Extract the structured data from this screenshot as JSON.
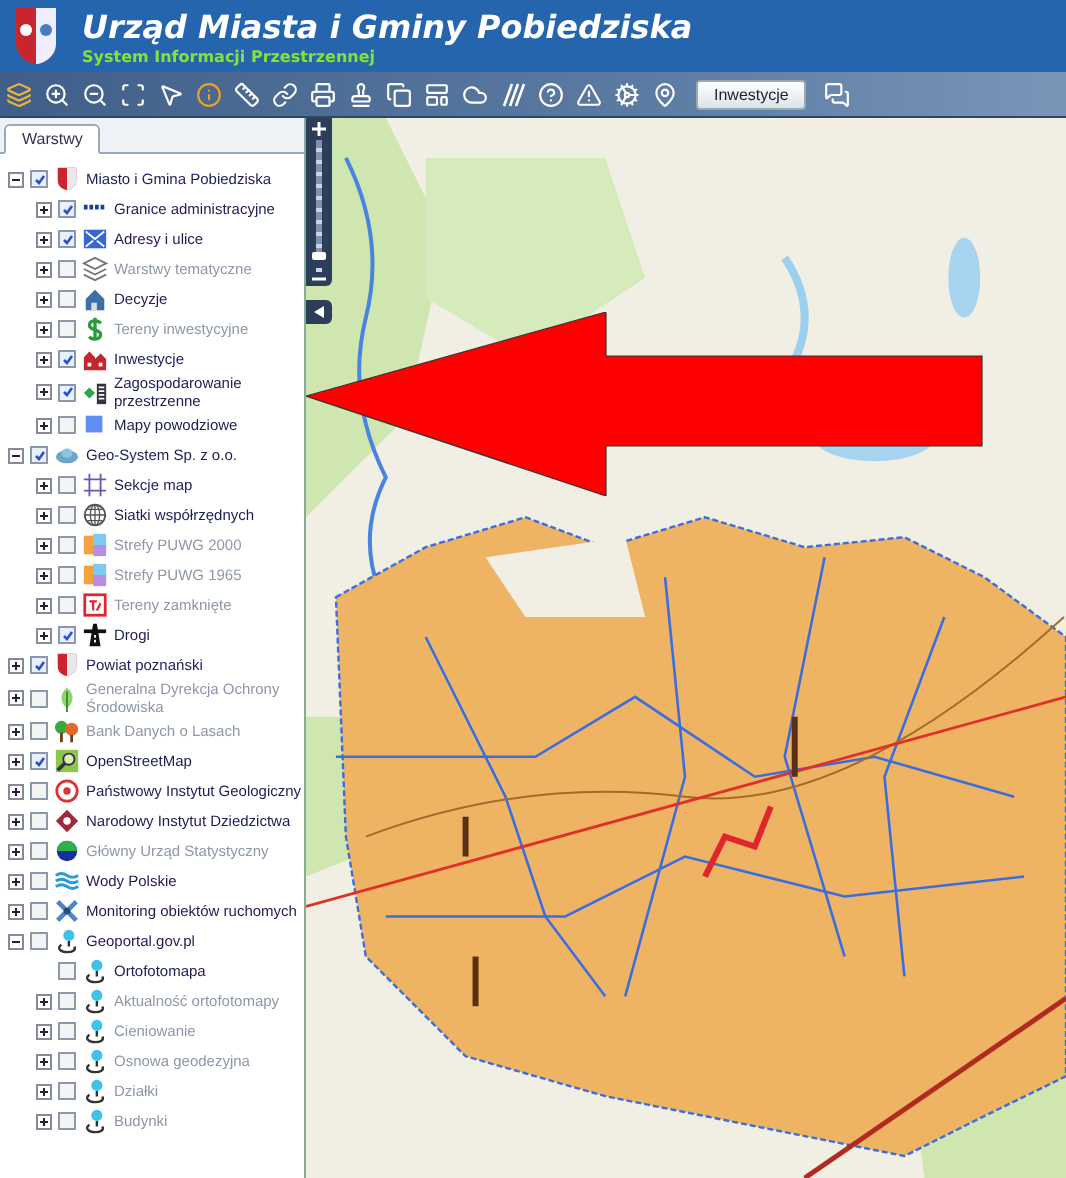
{
  "header": {
    "title": "Urząd Miasta i Gminy Pobiedziska",
    "subtitle": "System Informacji Przestrzennej"
  },
  "toolbar": {
    "button": "Inwestycje"
  },
  "tabs": [
    {
      "label": "Warstwy",
      "selected": true
    }
  ],
  "layers": [
    {
      "name": "Miasto i Gmina Pobiedziska",
      "kind": "crest",
      "checked": true,
      "disabled": false,
      "expanded": true,
      "children": [
        {
          "name": "Granice administracyjne",
          "kind": "boundary",
          "checked": true,
          "disabled": false,
          "expanded": false
        },
        {
          "name": "Adresy i ulice",
          "kind": "address",
          "checked": true,
          "disabled": false,
          "expanded": false
        },
        {
          "name": "Warstwy tematyczne",
          "kind": "stack",
          "checked": false,
          "disabled": true,
          "expanded": false
        },
        {
          "name": "Decyzje",
          "kind": "house",
          "checked": false,
          "disabled": false,
          "expanded": false
        },
        {
          "name": "Tereny inwestycyjne",
          "kind": "dollar",
          "checked": false,
          "disabled": true,
          "expanded": false
        },
        {
          "name": "Inwestycje",
          "kind": "buildings",
          "checked": true,
          "disabled": false,
          "expanded": false
        },
        {
          "name": "Zagospodarowanie przestrzenne",
          "kind": "plan",
          "checked": true,
          "disabled": false,
          "expanded": false
        },
        {
          "name": "Mapy powodziowe",
          "kind": "square",
          "checked": false,
          "disabled": false,
          "expanded": false
        }
      ]
    },
    {
      "name": "Geo-System Sp. z o.o.",
      "kind": "cloud",
      "checked": true,
      "disabled": false,
      "expanded": true,
      "children": [
        {
          "name": "Sekcje map",
          "kind": "grid",
          "checked": false,
          "disabled": false,
          "expanded": false
        },
        {
          "name": "Siatki współrzędnych",
          "kind": "globe",
          "checked": false,
          "disabled": false,
          "expanded": false
        },
        {
          "name": "Strefy PUWG 2000",
          "kind": "zones",
          "checked": false,
          "disabled": true,
          "expanded": false
        },
        {
          "name": "Strefy PUWG 1965",
          "kind": "zones",
          "checked": false,
          "disabled": true,
          "expanded": false
        },
        {
          "name": "Tereny zamknięte",
          "kind": "tz",
          "checked": false,
          "disabled": true,
          "expanded": false
        },
        {
          "name": "Drogi",
          "kind": "road",
          "checked": true,
          "disabled": false,
          "expanded": false
        }
      ]
    },
    {
      "name": "Powiat poznański",
      "kind": "crest",
      "checked": true,
      "disabled": false,
      "expanded": false
    },
    {
      "name": "Generalna Dyrekcja Ochrony Środowiska",
      "kind": "leaf",
      "checked": false,
      "disabled": true,
      "expanded": false
    },
    {
      "name": "Bank Danych o Lasach",
      "kind": "trees",
      "checked": false,
      "disabled": true,
      "expanded": false
    },
    {
      "name": "OpenStreetMap",
      "kind": "magnifier",
      "checked": true,
      "disabled": false,
      "expanded": false
    },
    {
      "name": "Państwowy Instytut Geologiczny",
      "kind": "ring",
      "checked": false,
      "disabled": false,
      "expanded": false
    },
    {
      "name": "Narodowy Instytut Dziedzictwa",
      "kind": "heritage",
      "checked": false,
      "disabled": false,
      "expanded": false
    },
    {
      "name": "Główny Urząd Statystyczny",
      "kind": "dot",
      "checked": false,
      "disabled": true,
      "expanded": false
    },
    {
      "name": "Wody Polskie",
      "kind": "waves",
      "checked": false,
      "disabled": false,
      "expanded": false
    },
    {
      "name": "Monitoring obiektów ruchomych",
      "kind": "satellite",
      "checked": false,
      "disabled": false,
      "expanded": false
    },
    {
      "name": "Geoportal.gov.pl",
      "kind": "pin",
      "checked": false,
      "disabled": false,
      "expanded": true,
      "children": [
        {
          "name": "Ortofotomapa",
          "kind": "pin",
          "checked": false,
          "disabled": false
        },
        {
          "name": "Aktualność ortofotomapy",
          "kind": "pin",
          "checked": false,
          "disabled": true,
          "expanded": false
        },
        {
          "name": "Cieniowanie",
          "kind": "pin",
          "checked": false,
          "disabled": true,
          "expanded": false
        },
        {
          "name": "Osnowa geodezyjna",
          "kind": "pin",
          "checked": false,
          "disabled": true,
          "expanded": false
        },
        {
          "name": "Działki",
          "kind": "pin",
          "checked": false,
          "disabled": true,
          "expanded": false
        },
        {
          "name": "Budynki",
          "kind": "pin",
          "checked": false,
          "disabled": true,
          "expanded": false
        }
      ]
    }
  ],
  "map": {
    "zoom": {
      "level": 0.88
    }
  }
}
